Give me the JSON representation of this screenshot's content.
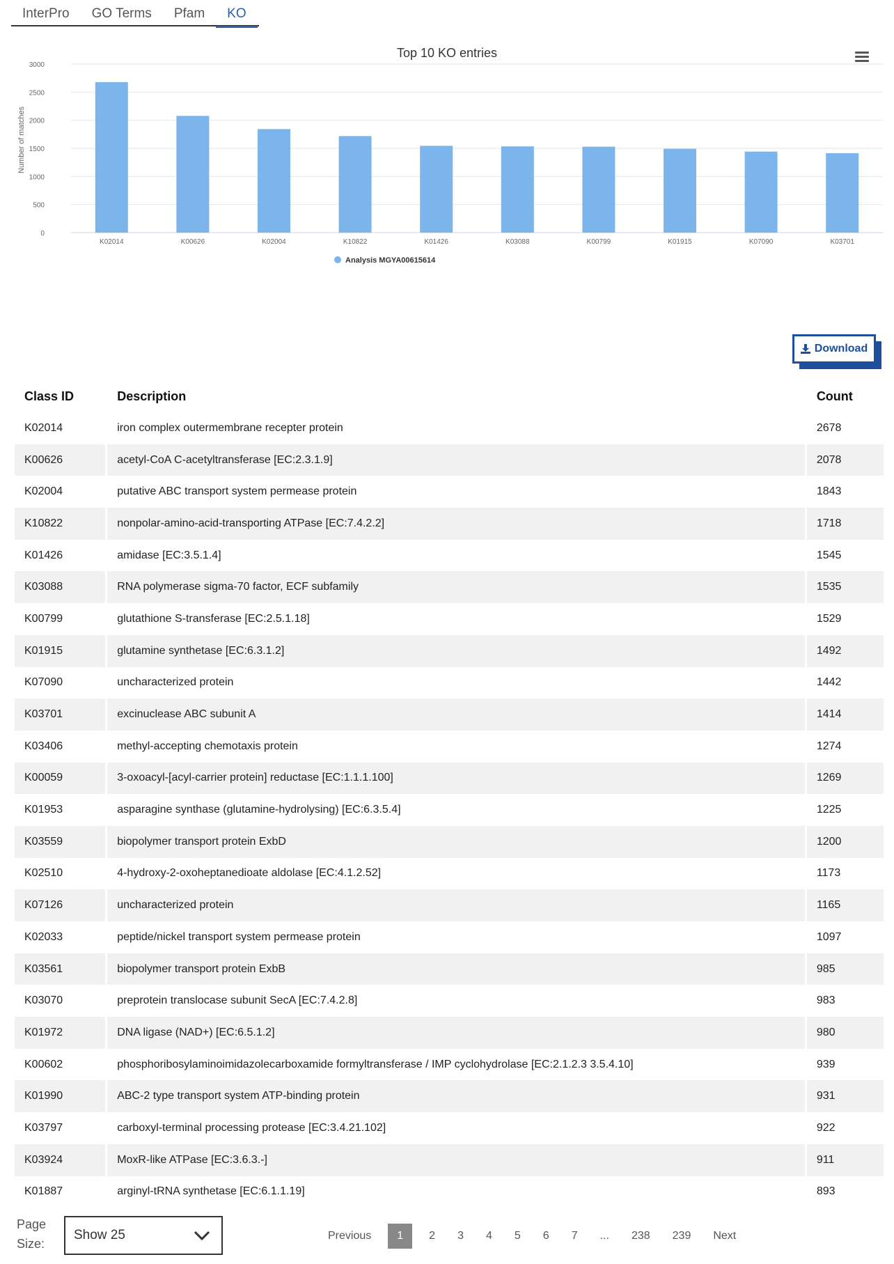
{
  "tabs": [
    {
      "label": "InterPro"
    },
    {
      "label": "GO Terms"
    },
    {
      "label": "Pfam"
    },
    {
      "label": "KO"
    }
  ],
  "download": {
    "label": "Download"
  },
  "table": {
    "headers": {
      "class_id": "Class ID",
      "description": "Description",
      "count": "Count"
    },
    "rows": [
      {
        "id": "K02014",
        "desc": "iron complex outermembrane recepter protein",
        "count": "2678"
      },
      {
        "id": "K00626",
        "desc": "acetyl-CoA C-acetyltransferase [EC:2.3.1.9]",
        "count": "2078"
      },
      {
        "id": "K02004",
        "desc": "putative ABC transport system permease protein",
        "count": "1843"
      },
      {
        "id": "K10822",
        "desc": "nonpolar-amino-acid-transporting ATPase [EC:7.4.2.2]",
        "count": "1718"
      },
      {
        "id": "K01426",
        "desc": "amidase [EC:3.5.1.4]",
        "count": "1545"
      },
      {
        "id": "K03088",
        "desc": "RNA polymerase sigma-70 factor, ECF subfamily",
        "count": "1535"
      },
      {
        "id": "K00799",
        "desc": "glutathione S-transferase [EC:2.5.1.18]",
        "count": "1529"
      },
      {
        "id": "K01915",
        "desc": "glutamine synthetase [EC:6.3.1.2]",
        "count": "1492"
      },
      {
        "id": "K07090",
        "desc": "uncharacterized protein",
        "count": "1442"
      },
      {
        "id": "K03701",
        "desc": "excinuclease ABC subunit A",
        "count": "1414"
      },
      {
        "id": "K03406",
        "desc": "methyl-accepting chemotaxis protein",
        "count": "1274"
      },
      {
        "id": "K00059",
        "desc": "3-oxoacyl-[acyl-carrier protein] reductase [EC:1.1.1.100]",
        "count": "1269"
      },
      {
        "id": "K01953",
        "desc": "asparagine synthase (glutamine-hydrolysing) [EC:6.3.5.4]",
        "count": "1225"
      },
      {
        "id": "K03559",
        "desc": "biopolymer transport protein ExbD",
        "count": "1200"
      },
      {
        "id": "K02510",
        "desc": "4-hydroxy-2-oxoheptanedioate aldolase [EC:4.1.2.52]",
        "count": "1173"
      },
      {
        "id": "K07126",
        "desc": "uncharacterized protein",
        "count": "1165"
      },
      {
        "id": "K02033",
        "desc": "peptide/nickel transport system permease protein",
        "count": "1097"
      },
      {
        "id": "K03561",
        "desc": "biopolymer transport protein ExbB",
        "count": "985"
      },
      {
        "id": "K03070",
        "desc": "preprotein translocase subunit SecA [EC:7.4.2.8]",
        "count": "983"
      },
      {
        "id": "K01972",
        "desc": "DNA ligase (NAD+) [EC:6.5.1.2]",
        "count": "980"
      },
      {
        "id": "K00602",
        "desc": "phosphoribosylaminoimidazolecarboxamide formyltransferase / IMP cyclohydrolase [EC:2.1.2.3 3.5.4.10]",
        "count": "939"
      },
      {
        "id": "K01990",
        "desc": "ABC-2 type transport system ATP-binding protein",
        "count": "931"
      },
      {
        "id": "K03797",
        "desc": "carboxyl-terminal processing protease [EC:3.4.21.102]",
        "count": "922"
      },
      {
        "id": "K03924",
        "desc": "MoxR-like ATPase [EC:3.6.3.-]",
        "count": "911"
      },
      {
        "id": "K01887",
        "desc": "arginyl-tRNA synthetase [EC:6.1.1.19]",
        "count": "893"
      }
    ]
  },
  "pagination": {
    "page_size_label": "Page Size:",
    "page_size_value": "Show 25",
    "previous": "Previous",
    "next": "Next",
    "pages": [
      "1",
      "2",
      "3",
      "4",
      "5",
      "6",
      "7",
      "...",
      "238",
      "239"
    ],
    "current": "1"
  },
  "colors": {
    "bar": "#7cb5ec",
    "accent": "#1c4f9c"
  },
  "chart_data": {
    "type": "bar",
    "title": "Top 10 KO entries",
    "ylabel": "Number of matches",
    "xlabel": "",
    "categories": [
      "K02014",
      "K00626",
      "K02004",
      "K10822",
      "K01426",
      "K03088",
      "K00799",
      "K01915",
      "K07090",
      "K03701"
    ],
    "series": [
      {
        "name": "Analysis MGYA00615614",
        "values": [
          2678,
          2078,
          1843,
          1718,
          1545,
          1535,
          1529,
          1492,
          1442,
          1414
        ]
      }
    ],
    "ylim": [
      0,
      3000
    ],
    "yticks": [
      0,
      500,
      1000,
      1500,
      2000,
      2500,
      3000
    ],
    "grid": true,
    "legend": "bottom-center"
  }
}
